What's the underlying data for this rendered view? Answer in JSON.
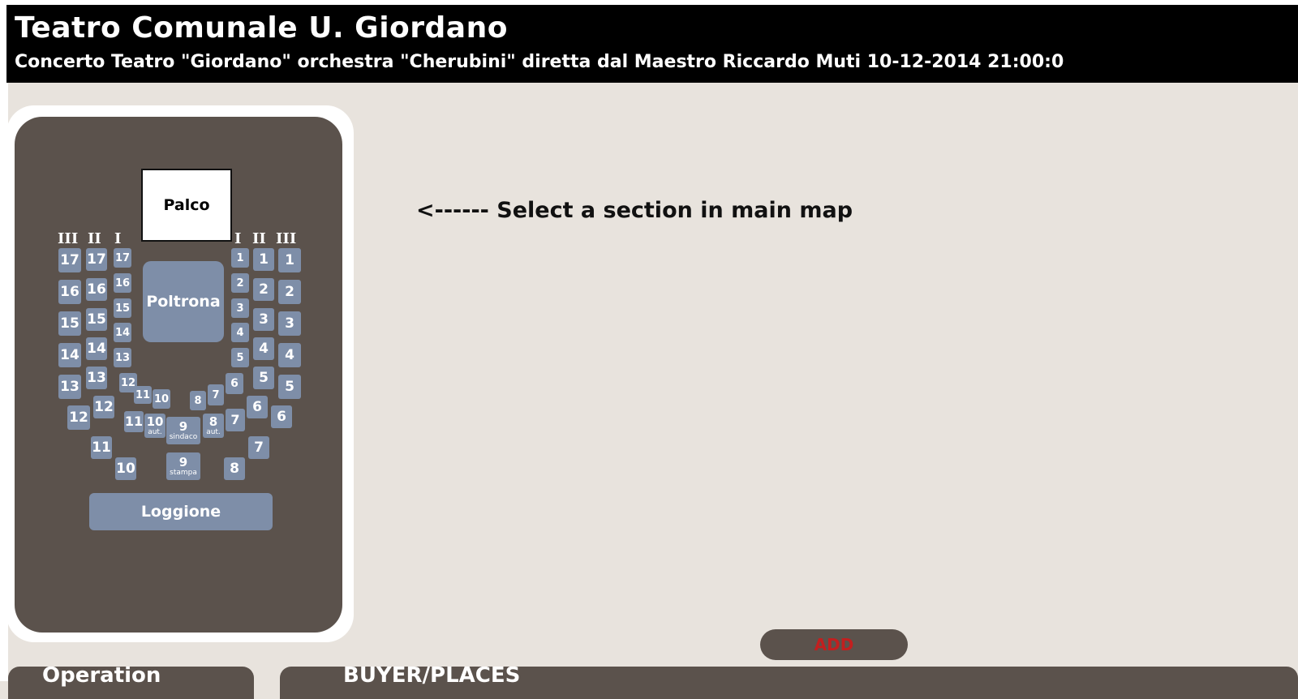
{
  "header": {
    "title": "Teatro Comunale U. Giordano",
    "subtitle": "Concerto Teatro \"Giordano\" orchestra \"Cherubini\" diretta dal Maestro Riccardo Muti  10-12-2014 21:00:0"
  },
  "map": {
    "stage": "Palco",
    "poltrona": "Poltrona",
    "loggione": "Loggione",
    "tier_labels": [
      "III",
      "II",
      "I",
      "I",
      "II",
      "III"
    ],
    "left_iii": [
      "17",
      "16",
      "15",
      "14",
      "13"
    ],
    "left_ii": [
      "17",
      "16",
      "15",
      "14",
      "13"
    ],
    "left_i": [
      "17",
      "16",
      "15",
      "14",
      "13",
      "12"
    ],
    "right_i": [
      "1",
      "2",
      "3",
      "4",
      "5",
      "6"
    ],
    "right_ii": [
      "1",
      "2",
      "3",
      "4",
      "5"
    ],
    "right_iii": [
      "1",
      "2",
      "3",
      "4",
      "5"
    ],
    "lower": {
      "b12a": "12",
      "b12b": "12",
      "b11a": "11",
      "b10a": "10",
      "b11b": "11",
      "b10b": "10",
      "b10c": "10",
      "b10c_sub": "aut.",
      "b9a": "9",
      "b9a_sub": "sindaco",
      "b9b": "9",
      "b9b_sub": "stampa",
      "b8a": "8",
      "b8b": "8",
      "b8b_sub": "aut.",
      "b8c": "8",
      "b7a": "7",
      "b7b": "7",
      "b7c": "7",
      "b6a": "6",
      "b6b": "6"
    }
  },
  "main": {
    "hint": "<------ Select a section in main map"
  },
  "actions": {
    "add_label": "ADD"
  },
  "panels": {
    "operation": "Operation",
    "buyer": "BUYER/PLACES"
  }
}
